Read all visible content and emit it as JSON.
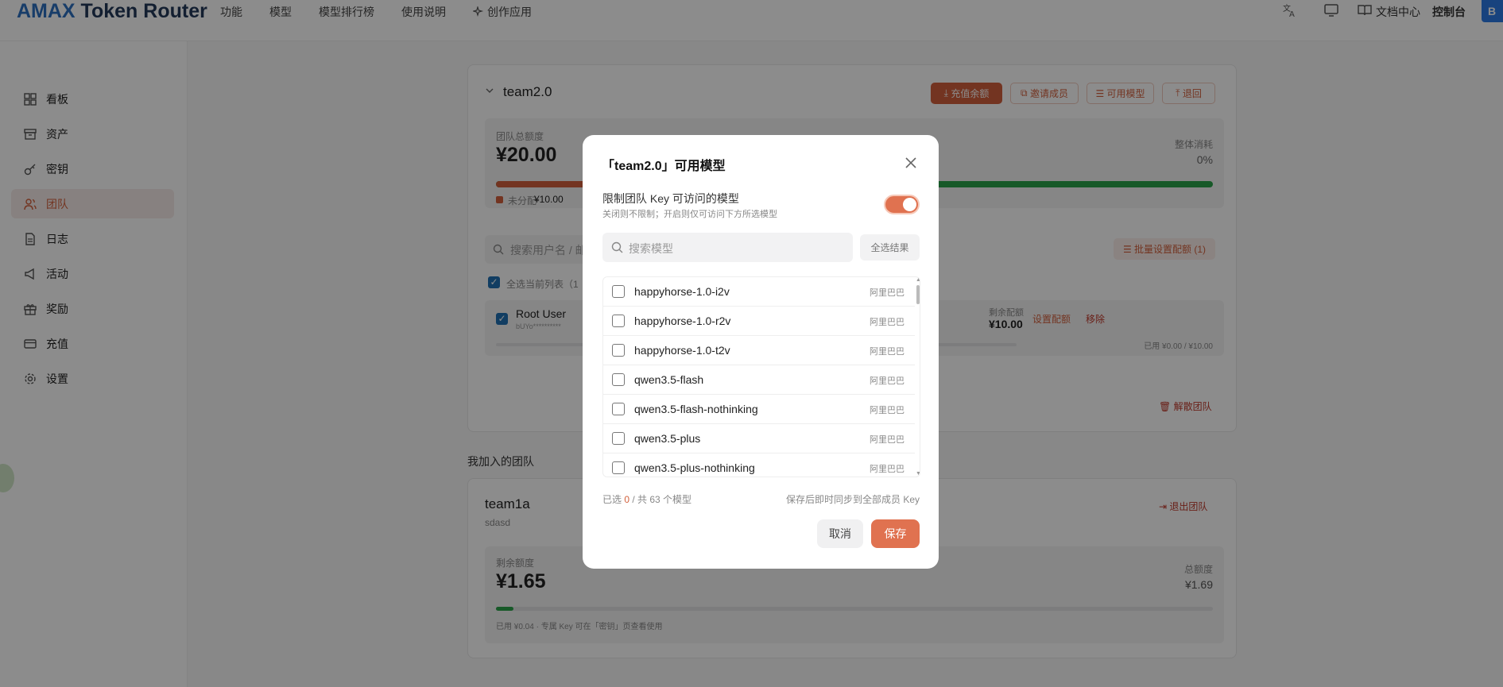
{
  "header": {
    "brand_prefix": "AMAX",
    "brand_suffix": " Token Router",
    "nav": [
      "功能",
      "模型",
      "模型排行榜",
      "使用说明",
      "创作应用"
    ],
    "docs": "文档中心",
    "console": "控制台",
    "avatar_letter": "B"
  },
  "sidebar": {
    "items": [
      {
        "label": "看板",
        "icon": "dashboard-icon"
      },
      {
        "label": "资产",
        "icon": "archive-icon"
      },
      {
        "label": "密钥",
        "icon": "key-icon"
      },
      {
        "label": "团队",
        "icon": "users-icon"
      },
      {
        "label": "日志",
        "icon": "file-icon"
      },
      {
        "label": "活动",
        "icon": "megaphone-icon"
      },
      {
        "label": "奖励",
        "icon": "gift-icon"
      },
      {
        "label": "充值",
        "icon": "card-icon"
      },
      {
        "label": "设置",
        "icon": "gear-icon"
      }
    ],
    "active": "团队"
  },
  "team_card": {
    "name": "team2.0",
    "buttons": [
      "充值余额",
      "邀请成员",
      "可用模型",
      "退回"
    ],
    "total_label": "团队总额度",
    "total_value": "¥20.00",
    "overall_label": "整体消耗",
    "overall_value": "0%",
    "unassigned_label": "未分配",
    "unassigned_value": "¥10.00",
    "search_placeholder": "搜索用户名 / 邮",
    "batch_button": "批量设置配额 (1)",
    "select_all_label": "全选当前列表（1",
    "member": {
      "name": "Root User",
      "key": "bUYo**********",
      "remaining_label": "剩余配额",
      "remaining_value": "¥10.00",
      "set_quota": "设置配额",
      "remove": "移除",
      "used": "已用 ¥0.00 / ¥10.00"
    },
    "dissolve": "解散团队"
  },
  "joined": {
    "section_title": "我加入的团队",
    "name": "team1a",
    "desc": "sdasd",
    "leave": "退出团队",
    "remaining_label": "剩余额度",
    "remaining_value": "¥1.65",
    "total_label": "总额度",
    "total_value": "¥1.69",
    "used_fraction": 0.024,
    "footnote": "已用 ¥0.04 · 专属 Key 可在「密钥」页查看使用"
  },
  "modal": {
    "title": "「team2.0」可用模型",
    "restrict_label": "限制团队 Key 可访问的模型",
    "restrict_desc": "关闭则不限制；开启则仅可访问下方所选模型",
    "restrict_on": true,
    "search_placeholder": "搜索模型",
    "select_all_button": "全选结果",
    "models": [
      {
        "name": "happyhorse-1.0-i2v",
        "vendor": "阿里巴巴"
      },
      {
        "name": "happyhorse-1.0-r2v",
        "vendor": "阿里巴巴"
      },
      {
        "name": "happyhorse-1.0-t2v",
        "vendor": "阿里巴巴"
      },
      {
        "name": "qwen3.5-flash",
        "vendor": "阿里巴巴"
      },
      {
        "name": "qwen3.5-flash-nothinking",
        "vendor": "阿里巴巴"
      },
      {
        "name": "qwen3.5-plus",
        "vendor": "阿里巴巴"
      },
      {
        "name": "qwen3.5-plus-nothinking",
        "vendor": "阿里巴巴"
      }
    ],
    "selected_prefix": "已选 ",
    "selected_count": "0",
    "selected_suffix": " / 共 63 个模型",
    "sync_note": "保存后即时同步到全部成员 Key",
    "cancel": "取消",
    "save": "保存"
  },
  "colors": {
    "accent": "#d2603c",
    "brand": "#2c6fbf",
    "progress_green": "#2aa34a"
  }
}
